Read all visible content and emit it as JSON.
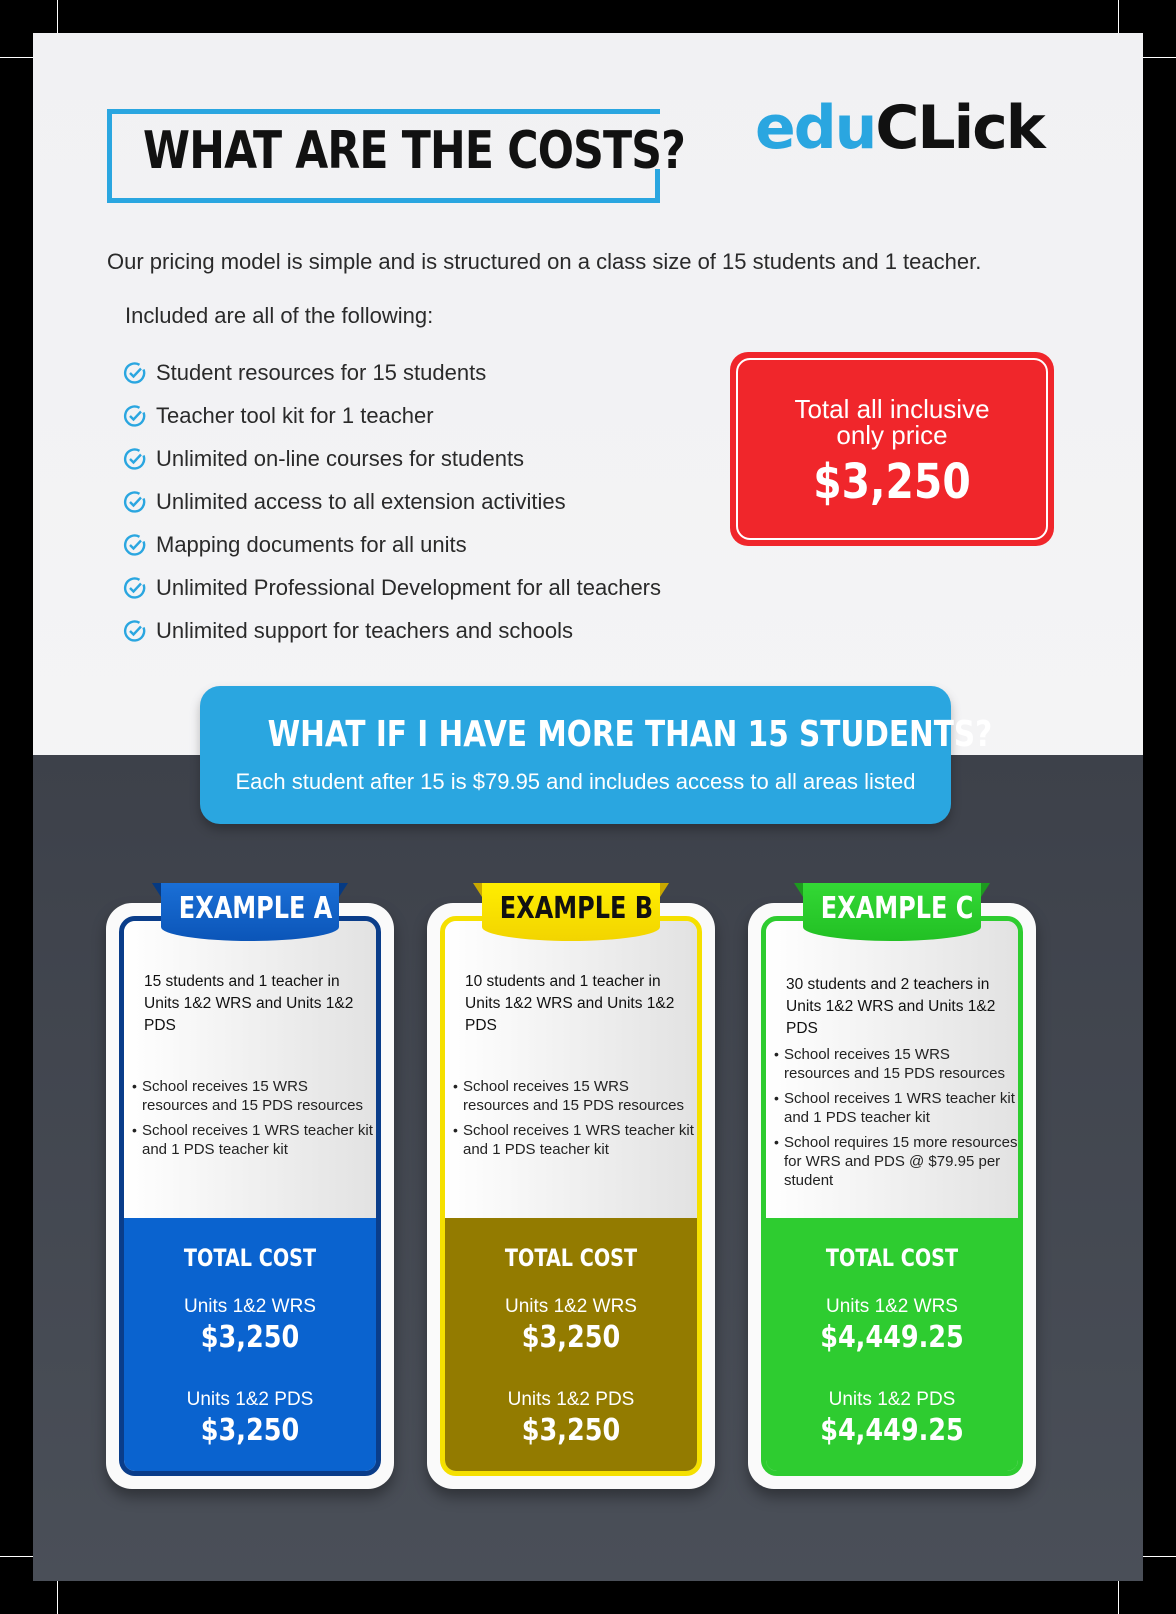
{
  "header": {
    "title": "WHAT ARE THE COSTS?",
    "logo_part1": "edu",
    "logo_part2": "CLick"
  },
  "intro": "Our pricing model is simple and is structured on a class size of 15 students and 1 teacher.",
  "included_label": "Included are all of the following:",
  "features": [
    "Student resources for 15 students",
    "Teacher tool kit for 1 teacher",
    "Unlimited on-line courses for students",
    "Unlimited access to all extension activities",
    "Mapping documents for all units",
    "Unlimited Professional Development for all teachers",
    "Unlimited support for teachers and schools"
  ],
  "price_box": {
    "label": "Total all inclusive only price",
    "value": "$3,250"
  },
  "more_students": {
    "title": "WHAT IF I HAVE MORE THAN 15 STUDENTS?",
    "subtitle": "Each student after 15 is $79.95 and includes access to all areas listed"
  },
  "examples": [
    {
      "title": "EXAMPLE A",
      "description": "15 students and 1 teacher in Units 1&2 WRS and Units 1&2 PDS",
      "bullets": [
        "School receives 15 WRS resources and 15 PDS resources",
        "School receives 1 WRS teacher kit and 1 PDS teacher kit"
      ],
      "total_label": "TOTAL COST",
      "unit1_label": "Units 1&2 WRS",
      "unit1_value": "$3,250",
      "unit2_label": "Units 1&2 PDS",
      "unit2_value": "$3,250"
    },
    {
      "title": "EXAMPLE B",
      "description": "10 students and 1 teacher in Units 1&2 WRS and Units 1&2 PDS",
      "bullets": [
        "School receives 15 WRS resources and 15 PDS resources",
        "School receives 1 WRS teacher kit and 1 PDS teacher kit"
      ],
      "total_label": "TOTAL COST",
      "unit1_label": "Units 1&2 WRS",
      "unit1_value": "$3,250",
      "unit2_label": "Units 1&2 PDS",
      "unit2_value": "$3,250"
    },
    {
      "title": "EXAMPLE C",
      "description": "30 students and 2 teachers in Units 1&2 WRS and Units 1&2 PDS",
      "bullets": [
        "School receives 15 WRS resources and 15 PDS resources",
        "School receives 1 WRS teacher kit and 1 PDS teacher kit",
        "School requires 15 more resources for WRS and PDS @ $79.95 per student"
      ],
      "total_label": "TOTAL COST",
      "unit1_label": "Units 1&2 WRS",
      "unit1_value": "$4,449.25",
      "unit2_label": "Units 1&2 PDS",
      "unit2_value": "$4,449.25"
    }
  ],
  "colors": {
    "accent_blue": "#2aa6e0",
    "price_red": "#f0262b",
    "dark_band": "#42464f",
    "example_a": "#0a63cf",
    "example_b": "#937b00",
    "example_c": "#2ecc30"
  },
  "icons": {
    "feature_bullet": "check-circle-icon"
  }
}
